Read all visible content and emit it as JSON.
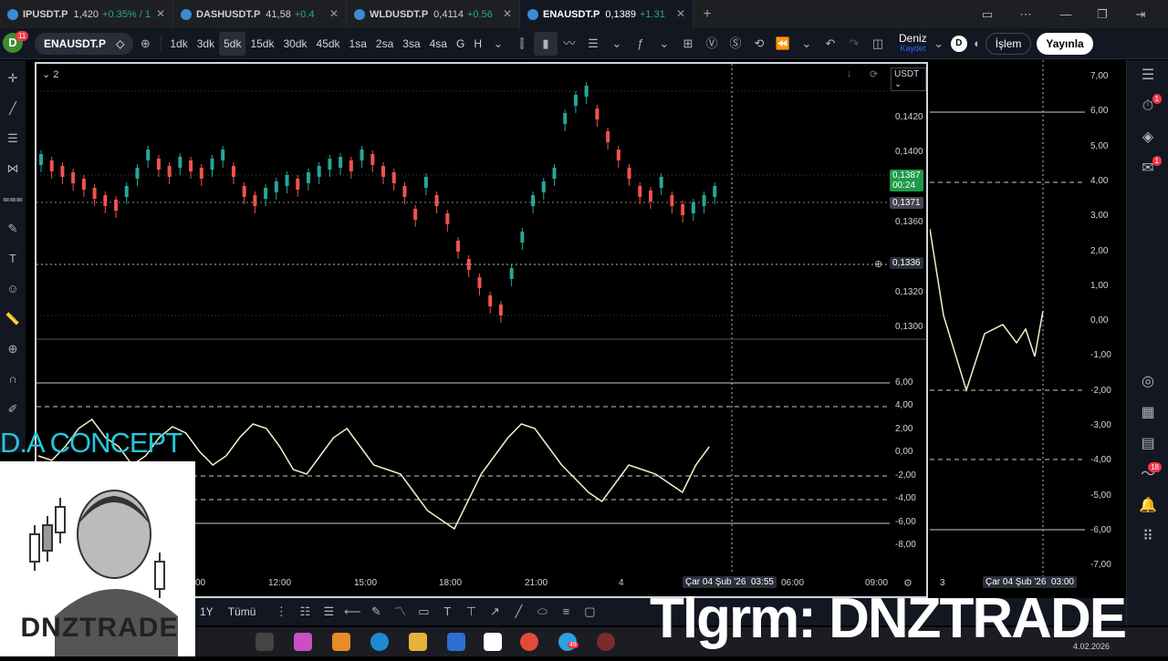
{
  "tabs": [
    {
      "symbol": "IPUSDT.P",
      "price": "1,420",
      "change": "+0.35% / 1"
    },
    {
      "symbol": "DASHUSDT.P",
      "price": "41,58",
      "change": "+0.4"
    },
    {
      "symbol": "WLDUSDT.P",
      "price": "0,4114",
      "change": "+0.56"
    },
    {
      "symbol": "ENAUSDT.P",
      "price": "0,1389",
      "change": "+1.31"
    }
  ],
  "toolbar": {
    "user_initial": "D",
    "user_badge": "11",
    "symbol": "ENAUSDT.P",
    "intervals": [
      "1dk",
      "3dk",
      "5dk",
      "15dk",
      "30dk",
      "45dk",
      "1sa",
      "2sa",
      "3sa",
      "4sa",
      "G",
      "H"
    ],
    "active_interval": "5dk",
    "layout_name": "Deniz",
    "layout_sub": "Kaydet",
    "layout_initial": "D",
    "trade_label": "İşlem",
    "publish_label": "Yayınla"
  },
  "chart": {
    "pane_collapse": "2",
    "currency": "USDT",
    "price_labels": [
      "0,1420",
      "0,1400",
      "0,1360",
      "0,1320",
      "0,1300"
    ],
    "last_price": "0,1387",
    "countdown": "00:24",
    "marker_price": "0,1371",
    "crosshair_price": "0,1336",
    "osc_labels": [
      "6,00",
      "4,00",
      "2,00",
      "0,00",
      "-2,00",
      "-4,00",
      "-6,00",
      "-8,00"
    ],
    "time_labels": [
      "00",
      "12:00",
      "15:00",
      "18:00",
      "21:00",
      "4",
      "06:00",
      "09:00"
    ],
    "crosshair_time": "Çar 04 Şub '26",
    "crosshair_time2": "03:55"
  },
  "right_chart": {
    "axis_labels": [
      "7,00",
      "6,00",
      "5,00",
      "4,00",
      "3,00",
      "2,00",
      "1,00",
      "0,00",
      "-1,00",
      "-2,00",
      "-3,00",
      "-4,00",
      "-5,00",
      "-6,00",
      "-7,00"
    ],
    "time_label": "Çar 04 Şub '26",
    "time_label2": "03:00",
    "time_left": "3"
  },
  "right_badges": {
    "alerts": "1",
    "chat": "1",
    "feed": "18"
  },
  "bottom": {
    "range_1y": "1Y",
    "range_all": "Tümü"
  },
  "taskbar": {
    "date": "4.02.2026",
    "browser_badge": "49"
  },
  "overlay": {
    "title": "D.A CONCEPT",
    "logo_text": "DNZTRADE",
    "telegram": "Tlgrm: DNZTRADE"
  },
  "colors": {
    "up": "#26a69a",
    "down": "#ef5350",
    "oscillator": "#f5f0c8",
    "background": "#000000",
    "accent": "#2962ff"
  }
}
